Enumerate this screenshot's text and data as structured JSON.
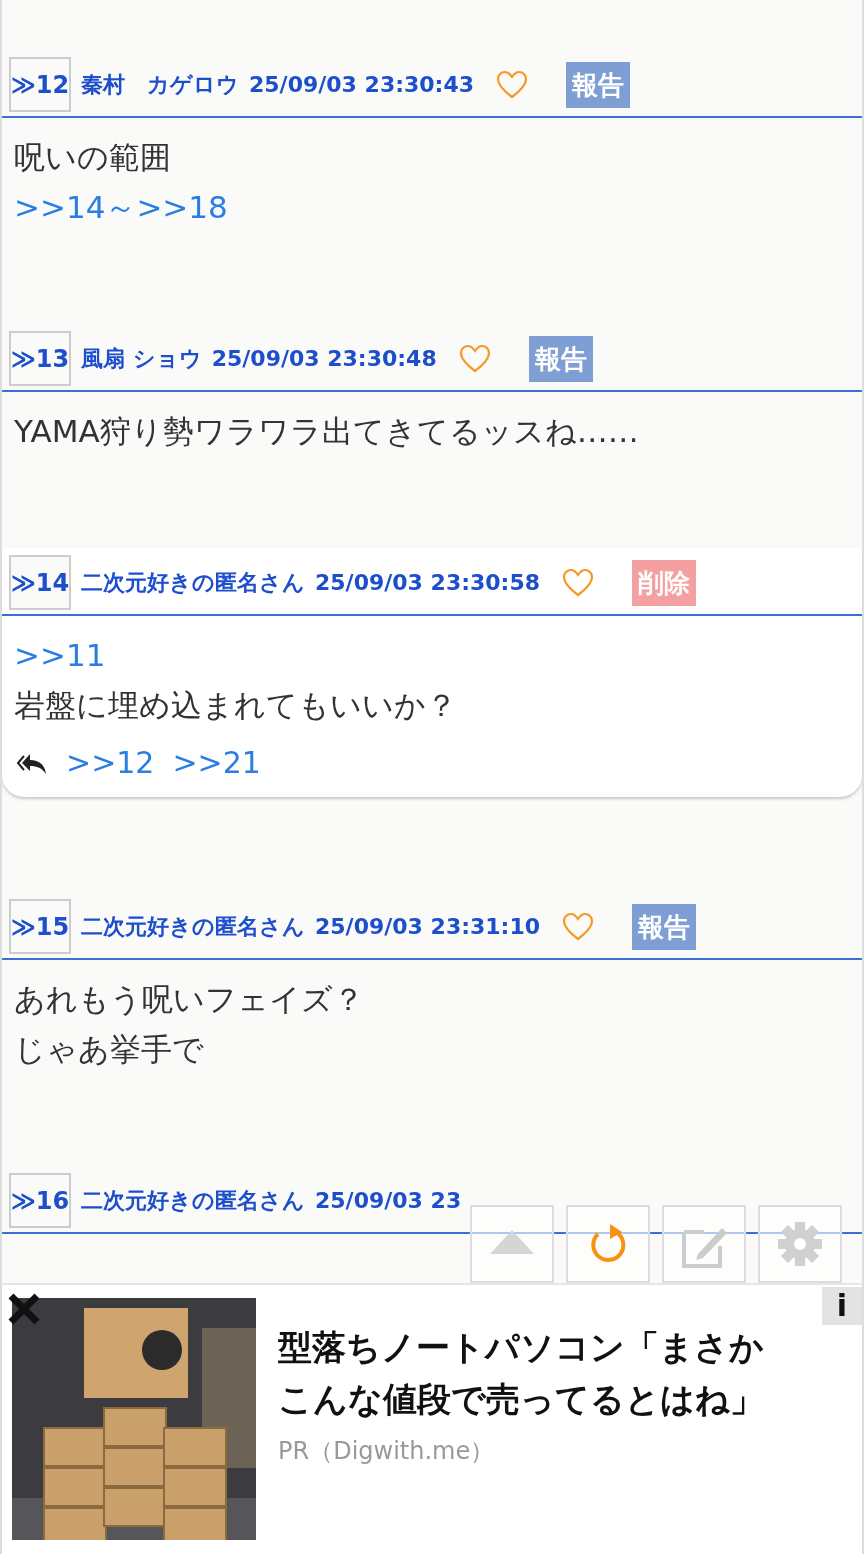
{
  "posts": [
    {
      "number": "≫12",
      "name": "秦村　カゲロウ",
      "datetime": "25/09/03 23:30:43",
      "action": {
        "kind": "report",
        "label": "報告"
      },
      "lines": [
        {
          "kind": "text",
          "text": "呪いの範囲"
        },
        {
          "kind": "anchor",
          "text": ">>14～>>18"
        }
      ]
    },
    {
      "number": "≫13",
      "name": "風扇 ショウ",
      "datetime": "25/09/03 23:30:48",
      "action": {
        "kind": "report",
        "label": "報告"
      },
      "lines": [
        {
          "kind": "text",
          "text": "YAMA狩り勢ワラワラ出てきてるッスね……"
        }
      ]
    },
    {
      "number": "≫14",
      "name": "二次元好きの匿名さん",
      "datetime": "25/09/03 23:30:58",
      "action": {
        "kind": "delete",
        "label": "削除"
      },
      "lines": [
        {
          "kind": "anchor",
          "text": ">>11"
        },
        {
          "kind": "text",
          "text": "岩盤に埋め込まれてもいいか？"
        }
      ],
      "replies": [
        ">>12",
        ">>21"
      ]
    },
    {
      "number": "≫15",
      "name": "二次元好きの匿名さん",
      "datetime": "25/09/03 23:31:10",
      "action": {
        "kind": "report",
        "label": "報告"
      },
      "lines": [
        {
          "kind": "text",
          "text": "あれもう呪いフェイズ？"
        },
        {
          "kind": "text",
          "text": "じゃあ挙手で"
        }
      ]
    },
    {
      "number": "≫16",
      "name": "二次元好きの匿名さん",
      "datetime": "25/09/03 23"
    }
  ],
  "toolbar": {
    "buttons": [
      {
        "kind": "top"
      },
      {
        "kind": "reload"
      },
      {
        "kind": "write"
      },
      {
        "kind": "settings"
      }
    ]
  },
  "ad": {
    "kind": "picture",
    "title": "型落ちノートパソコン「まさかこんな値段で売ってるとはね」",
    "source": "PR（Digwith.me）",
    "info_label": "i"
  }
}
